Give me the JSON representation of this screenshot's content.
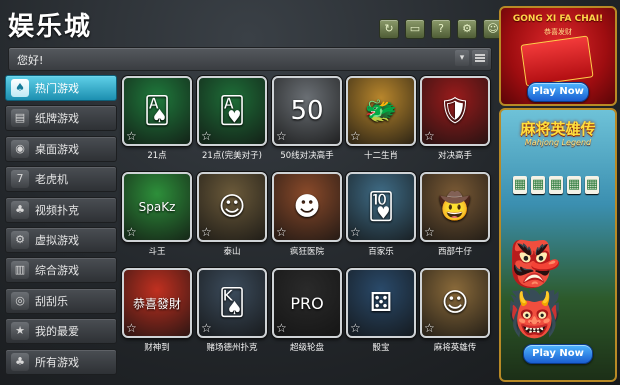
{
  "app": {
    "title": "娱乐城"
  },
  "toolbar": {
    "buttons": [
      {
        "name": "refresh-button",
        "glyph": "↻"
      },
      {
        "name": "screen-button",
        "glyph": "▭"
      },
      {
        "name": "help-button",
        "glyph": "?"
      },
      {
        "name": "settings-button",
        "glyph": "⚙"
      },
      {
        "name": "user-button",
        "glyph": "☺"
      }
    ]
  },
  "greeting": {
    "text": "您好!"
  },
  "sidebar": {
    "items": [
      {
        "label": "热门游戏",
        "icon": "♠",
        "active": true
      },
      {
        "label": "纸牌游戏",
        "icon": "▤"
      },
      {
        "label": "桌面游戏",
        "icon": "◉"
      },
      {
        "label": "老虎机",
        "icon": "7"
      },
      {
        "label": "视频扑克",
        "icon": "♣"
      },
      {
        "label": "虚拟游戏",
        "icon": "⚙"
      },
      {
        "label": "综合游戏",
        "icon": "▥"
      },
      {
        "label": "刮刮乐",
        "icon": "◎"
      },
      {
        "label": "我的最爱",
        "icon": "★"
      },
      {
        "label": "所有游戏",
        "icon": "♣"
      }
    ]
  },
  "games": [
    {
      "label": "21点",
      "art": "🂡",
      "bg": "#1f7a3c"
    },
    {
      "label": "21点(完美对子)",
      "art": "🂱",
      "bg": "#1e6e38"
    },
    {
      "label": "50线对决高手",
      "art": "50",
      "bg": "#6a6f74"
    },
    {
      "label": "十二生肖",
      "art": "🐲",
      "bg": "#b8862c"
    },
    {
      "label": "对决高手",
      "art": "🛡",
      "bg": "#9a1b1b"
    },
    {
      "label": "斗王",
      "art": "SpaKz",
      "bg": "#2d8f3a"
    },
    {
      "label": "泰山",
      "art": "☺",
      "bg": "#6b5a3a"
    },
    {
      "label": "疯狂医院",
      "art": "☻",
      "bg": "#8a4a2a"
    },
    {
      "label": "百家乐",
      "art": "🂺",
      "bg": "#3f6c86"
    },
    {
      "label": "西部牛仔",
      "art": "🤠",
      "bg": "#7a5a35"
    },
    {
      "label": "财神到",
      "art": "恭喜發財",
      "bg": "#c03020"
    },
    {
      "label": "赌场德州扑克",
      "art": "🂮",
      "bg": "#3c4c5c"
    },
    {
      "label": "超级轮盘",
      "art": "PRO",
      "bg": "#2a2a2a"
    },
    {
      "label": "骰宝",
      "art": "⚄",
      "bg": "#2a4a6a"
    },
    {
      "label": "麻将英雄传",
      "art": "☺",
      "bg": "#8a6a3a"
    }
  ],
  "ads": {
    "gong": {
      "title": "GONG XI FA CHAI!",
      "subtitle": "恭喜发财",
      "button": "Play Now"
    },
    "mahjong": {
      "title": "麻将英雄传",
      "subtitle": "Mahjong Legend",
      "button": "Play Now"
    }
  }
}
